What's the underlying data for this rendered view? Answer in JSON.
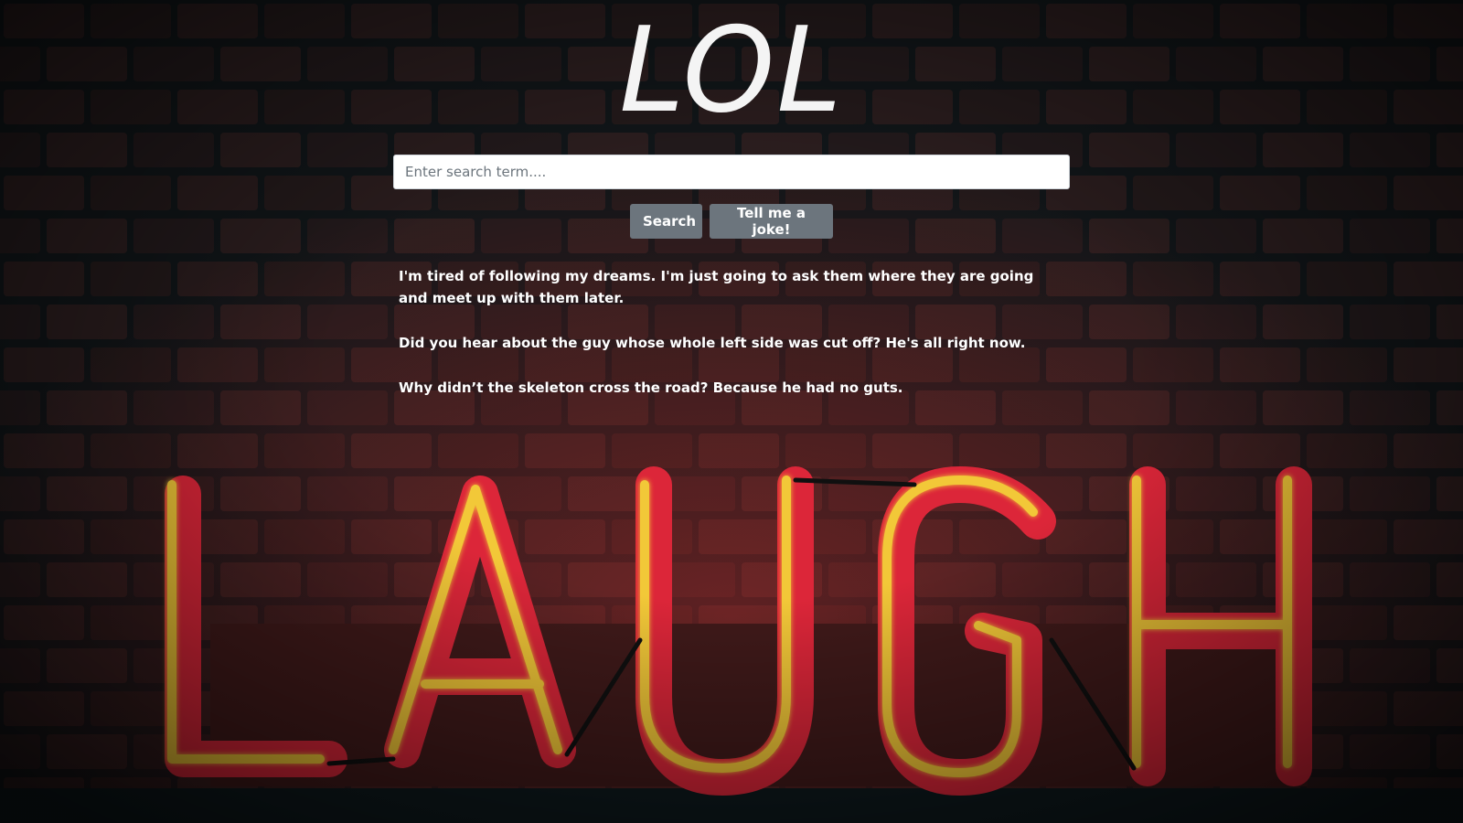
{
  "page": {
    "title": "LOL"
  },
  "search": {
    "placeholder": "Enter search term....",
    "value": ""
  },
  "buttons": {
    "search_label": "Search",
    "joke_label": "Tell me a joke!"
  },
  "jokes": [
    "I'm tired of following my dreams. I'm just going to ask them where they are going and meet up with them later.",
    "Did you hear about the guy whose whole left side was cut off? He's all right now.",
    "Why didn’t the skeleton cross the road? Because he had no guts."
  ],
  "background": {
    "sign_text": "LAUGH",
    "colors": {
      "wall": "#141a1e",
      "brick": "#2a1c1c",
      "neon_tube": "#ffd23a",
      "neon_frame": "#e8283c",
      "plank": "#5a2424"
    },
    "icon": "neon-laugh-sign"
  }
}
